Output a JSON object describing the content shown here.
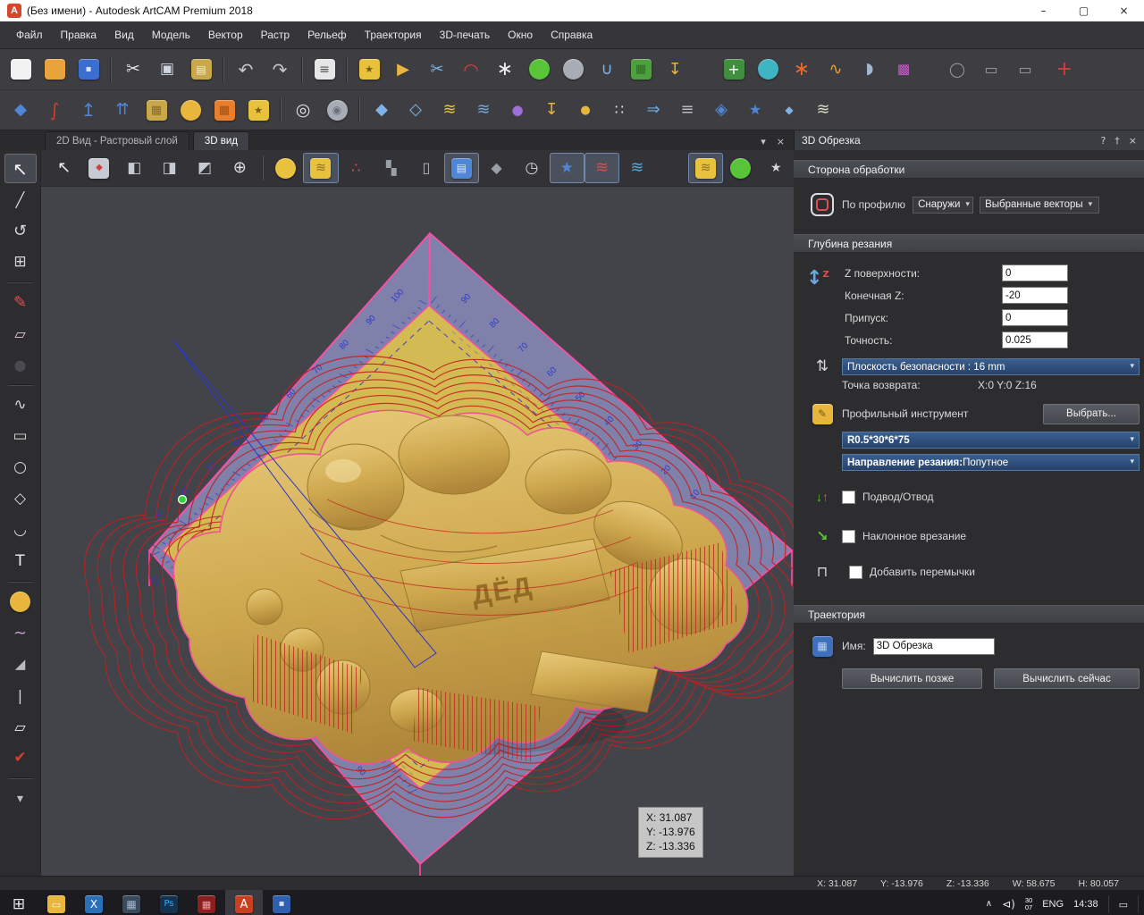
{
  "window": {
    "title": "(Без имени) - Autodesk ArtCAM Premium 2018",
    "app_initial": "A"
  },
  "colors": {
    "plane_yellow": "#d4ba52",
    "plane_purple": "#7f81ab",
    "edge_pink": "#ff4da6",
    "toolpath_red": "#c21f1f",
    "ruler_blue": "#2b39c9",
    "viewport_bg": "#43444a",
    "accent_blue": "#31547f"
  },
  "menu": {
    "items": [
      "Файл",
      "Правка",
      "Вид",
      "Модель",
      "Вектор",
      "Растр",
      "Рельеф",
      "Траектория",
      "3D-печать",
      "Окно",
      "Справка"
    ]
  },
  "toolbar_file": [
    {
      "name": "new-model-icon",
      "chip": "#f2f2f2"
    },
    {
      "name": "open-model-icon",
      "chip": "#e8a33d"
    },
    {
      "name": "save-model-icon",
      "chip": "#3a6fd0",
      "g": "▪",
      "fg": "#d8e4f5",
      "fs": 10
    },
    {
      "sep": true
    },
    {
      "name": "cut-icon",
      "g": "✂",
      "fg": "#e0e0e0",
      "fs": 19
    },
    {
      "name": "copy-icon",
      "g": "▣",
      "fg": "#cfd6df",
      "fs": 17
    },
    {
      "name": "paste-icon",
      "chip": "#c8a84b",
      "g": "▤",
      "fg": "#f5ead0",
      "fs": 12
    },
    {
      "sep": true
    },
    {
      "name": "undo-icon",
      "g": "↶",
      "fg": "#c8c8c8",
      "fs": 20
    },
    {
      "name": "redo-icon",
      "g": "↷",
      "fg": "#c8c8c8",
      "fs": 20
    },
    {
      "sep": true
    },
    {
      "name": "job-sheet-icon",
      "chip": "#e6e6e6",
      "g": "≡",
      "fg": "#555555",
      "fs": 14
    },
    {
      "sep": true
    },
    {
      "name": "import-vectors-icon",
      "chip": "#e8c23d",
      "g": "★",
      "fg": "#7a5a10",
      "fs": 11
    },
    {
      "name": "vector-doctor-icon",
      "g": "▶",
      "fg": "#e8b63d",
      "fs": 18
    },
    {
      "name": "trim-vectors-icon",
      "g": "✂",
      "fg": "#7fb3e8",
      "fs": 18
    },
    {
      "name": "fillet-tool-icon",
      "g": "◠",
      "fg": "#d84040",
      "fs": 20
    },
    {
      "name": "paste-along-curve-icon",
      "g": "∗",
      "fg": "#eeeeee",
      "fs": 22
    },
    {
      "name": "sphere-tool-icon",
      "chip": "#58c437",
      "round": true
    },
    {
      "name": "mesh-tool-icon",
      "chip": "#a8adb5",
      "round": true
    },
    {
      "name": "extrude-tool-icon",
      "g": "∪",
      "fg": "#7fb3e8",
      "fs": 18
    },
    {
      "name": "texture-chip-icon",
      "chip": "#4f9e3f",
      "g": "▦",
      "fg": "#2c6e22",
      "fs": 13
    },
    {
      "name": "pin-tool-icon",
      "g": "↧",
      "fg": "#e8b63d",
      "fs": 18
    },
    {
      "gap": 28
    },
    {
      "name": "add-clipart-icon",
      "chip": "#3f8f3f",
      "g": "+",
      "fg": "#ffffff",
      "fs": 16
    },
    {
      "name": "smooth-blob-icon",
      "chip": "#3fb5c4",
      "round": true
    },
    {
      "name": "burst-tool-icon",
      "g": "∗",
      "fg": "#e86830",
      "fs": 22
    },
    {
      "name": "swirl-tool-icon",
      "g": "∿",
      "fg": "#e8a030",
      "fs": 18
    },
    {
      "name": "wrap-tool-icon",
      "g": "◗",
      "fg": "#9fb6d0",
      "fs": 17
    },
    {
      "name": "two-rail-icon",
      "g": "▩",
      "fg": "#d05ad0",
      "fs": 15
    },
    {
      "gap": 22
    },
    {
      "name": "ghost-circle-icon",
      "g": "◯",
      "fg": "#9a9aa0",
      "fs": 16
    },
    {
      "name": "ghost-slot-1-icon",
      "g": "▭",
      "fg": "#9a9aa0",
      "fs": 16
    },
    {
      "name": "ghost-slot-2-icon",
      "g": "▭",
      "fg": "#9a9aa0",
      "fs": 16
    },
    {
      "gap": 6
    },
    {
      "name": "transform-mode-icon",
      "g": "+",
      "fg": "#d83a3a",
      "fs": 22
    }
  ],
  "toolbar_relief": [
    {
      "name": "relief-smooth-icon",
      "g": "◆",
      "fg": "#4f86d8",
      "fs": 18
    },
    {
      "name": "relief-reset-icon",
      "g": "∫",
      "fg": "#d04030",
      "fs": 20
    },
    {
      "name": "relief-raise-icon",
      "g": "↥",
      "fg": "#4f86d8",
      "fs": 20
    },
    {
      "name": "relief-scale-icon",
      "g": "⇈",
      "fg": "#4f86d8",
      "fs": 18
    },
    {
      "name": "weave-wizard-icon",
      "chip": "#c8a84b",
      "g": "▦",
      "fg": "#8a6b2a",
      "fs": 13
    },
    {
      "name": "shape-droplet-icon",
      "chip": "#e8b63d",
      "round": true
    },
    {
      "name": "texture-relief-icon",
      "chip": "#e87f2f",
      "g": "▦",
      "fg": "#a04f10",
      "fs": 13
    },
    {
      "name": "import-relief-icon",
      "chip": "#e8c23d",
      "g": "★",
      "fg": "#7a5a10",
      "fs": 11
    },
    {
      "sep": true
    },
    {
      "name": "zoom-objects-icon",
      "g": "◎",
      "fg": "#e0e0e0",
      "fs": 19
    },
    {
      "name": "preview-relief-icon",
      "chip": "#a8adb5",
      "round": true,
      "g": "◉",
      "fg": "#6a707a",
      "fs": 12
    },
    {
      "sep": true
    },
    {
      "name": "layer-flat-icon",
      "g": "◆",
      "fg": "#7fb3e8",
      "fs": 18
    },
    {
      "name": "layer-offset-icon",
      "g": "◇",
      "fg": "#7fb3e8",
      "fs": 18
    },
    {
      "name": "layer-gold-icon",
      "g": "≋",
      "fg": "#e8c23d",
      "fs": 18
    },
    {
      "name": "layer-blue-icon",
      "g": "≋",
      "fg": "#6fa8dc",
      "fs": 18
    },
    {
      "name": "layer-sphere-icon",
      "g": "●",
      "fg": "#9f6fd8",
      "fs": 15
    },
    {
      "name": "layer-pin-icon",
      "g": "↧",
      "fg": "#e8b63d",
      "fs": 18
    },
    {
      "name": "layer-drop-icon",
      "g": "●",
      "fg": "#e8b63d",
      "fs": 13
    },
    {
      "name": "layer-scatter-icon",
      "g": "∷",
      "fg": "#e8e8e8",
      "fs": 16
    },
    {
      "name": "layer-shift-icon",
      "g": "⇒",
      "fg": "#6fa8dc",
      "fs": 18
    },
    {
      "name": "layer-stack-icon",
      "g": "≡",
      "fg": "#b8b8c0",
      "fs": 18
    },
    {
      "name": "layer-diamond-icon",
      "g": "◈",
      "fg": "#4f86d8",
      "fs": 18
    },
    {
      "name": "layer-star-icon",
      "g": "★",
      "fg": "#4f86d8",
      "fs": 16
    },
    {
      "name": "layer-small-icon",
      "g": "◆",
      "fg": "#7fb3e8",
      "fs": 12
    },
    {
      "name": "layer-pale-icon",
      "g": "≋",
      "fg": "#d8d8c8",
      "fs": 18
    }
  ],
  "toolbar_view": [
    {
      "name": "select-cursor-icon",
      "g": "↖",
      "fg": "#f0f0f0",
      "fs": 18
    },
    {
      "name": "iso-view-icon",
      "chip": "#c6cad2",
      "g": "◆",
      "fg": "#d04040",
      "fs": 10
    },
    {
      "name": "view-front-icon",
      "g": "◧",
      "fg": "#c6cad2",
      "fs": 17
    },
    {
      "name": "view-side-icon",
      "g": "◨",
      "fg": "#c6cad2",
      "fs": 17
    },
    {
      "name": "view-top-icon",
      "g": "◩",
      "fg": "#c6cad2",
      "fs": 17
    },
    {
      "name": "zoom-view-icon",
      "g": "⊕",
      "fg": "#e0e0e0",
      "fs": 18
    },
    {
      "sep": true
    },
    {
      "name": "light-icon",
      "chip": "#e8c23d",
      "round": true
    },
    {
      "name": "draft-layer-icon",
      "chip": "#e8c23d",
      "g": "≋",
      "fg": "#8a6b2a",
      "fs": 14,
      "active": true
    },
    {
      "name": "origin-triad-icon",
      "g": "∴",
      "fg": "#e05050",
      "fs": 16
    },
    {
      "name": "puzzle-icon",
      "g": "▚",
      "fg": "#9aa0a8",
      "fs": 15
    },
    {
      "name": "cylinder-icon",
      "g": "▯",
      "fg": "#b8b8c0",
      "fs": 16
    },
    {
      "name": "block-model-icon",
      "chip": "#4f86d8",
      "g": "▤",
      "fg": "#dce8f8",
      "fs": 12,
      "active": true
    },
    {
      "name": "material-icon",
      "g": "◆",
      "fg": "#9aa0a8",
      "fs": 16
    },
    {
      "name": "simulate-clock-icon",
      "g": "◷",
      "fg": "#d8d8d8",
      "fs": 17
    },
    {
      "name": "toolpath-star-icon",
      "g": "★",
      "fg": "#4f86d8",
      "fs": 17,
      "active": true
    },
    {
      "name": "toolpath-layers-icon",
      "g": "≋",
      "fg": "#d05050",
      "fs": 18,
      "active": true
    },
    {
      "name": "levels-icon",
      "g": "≋",
      "fg": "#58a8d0",
      "fs": 18
    },
    {
      "gap": 38
    },
    {
      "name": "draft-gold-icon",
      "chip": "#e8c23d",
      "g": "≋",
      "fg": "#8a6b2a",
      "fs": 14,
      "active": true
    },
    {
      "name": "shape-green-icon",
      "chip": "#58c437",
      "round": true
    },
    {
      "name": "find-vectors-icon",
      "g": "★",
      "fg": "#d8d8d8",
      "fs": 14
    }
  ],
  "toolbar_draw": [
    {
      "name": "select-tool-icon",
      "g": "↖",
      "fg": "#f5f5f5",
      "fs": 20,
      "active": true
    },
    {
      "name": "node-edit-tool-icon",
      "g": "╱",
      "fg": "#d8d8d8",
      "fs": 16
    },
    {
      "name": "transform-tool-icon",
      "g": "↺",
      "fg": "#d8d8d8",
      "fs": 18
    },
    {
      "name": "distort-grid-tool-icon",
      "g": "⊞",
      "fg": "#d8d8d8",
      "fs": 17
    },
    {
      "sep": true
    },
    {
      "name": "draw-tool-icon",
      "g": "✎",
      "fg": "#e05050",
      "fs": 18
    },
    {
      "name": "erase-tool-icon",
      "g": "▱",
      "fg": "#e8c8d8",
      "fs": 16
    },
    {
      "name": "flood-fill-tool-icon",
      "g": "●",
      "fg": "#4a4a50",
      "fs": 16
    },
    {
      "sep": true
    },
    {
      "name": "polyline-tool-icon",
      "g": "∿",
      "fg": "#d8d8d8",
      "fs": 17
    },
    {
      "name": "rectangle-tool-icon",
      "g": "▭",
      "fg": "#d8d8d8",
      "fs": 17
    },
    {
      "name": "ellipse-tool-icon",
      "g": "○",
      "fg": "#d8d8d8",
      "fs": 17
    },
    {
      "name": "polygon-tool-icon",
      "g": "◇",
      "fg": "#d8d8d8",
      "fs": 17
    },
    {
      "name": "arc-tool-icon",
      "g": "◡",
      "fg": "#d8d8d8",
      "fs": 17
    },
    {
      "name": "text-tool-icon",
      "g": "T",
      "fg": "#f0f0f0",
      "fs": 17
    },
    {
      "sep": true
    },
    {
      "name": "sculpt-smooth-tool-icon",
      "chip": "#e8b63d",
      "round": true
    },
    {
      "name": "smudge-tool-icon",
      "g": "∼",
      "fg": "#c8a0d0",
      "fs": 18
    },
    {
      "name": "deposit-tool-icon",
      "g": "◢",
      "fg": "#b8b8c0",
      "fs": 15
    },
    {
      "name": "brush-tool-icon",
      "g": "|",
      "fg": "#d8d8d8",
      "fs": 16
    },
    {
      "name": "erase-relief-tool-icon",
      "g": "▱",
      "fg": "#f0f0f0",
      "fs": 16
    },
    {
      "name": "smooth-relief-tool-icon",
      "g": "✔",
      "fg": "#d04030",
      "fs": 17
    },
    {
      "sep": true
    },
    {
      "name": "more-tools-icon",
      "g": "▾",
      "fg": "#c0c0c0",
      "fs": 14
    }
  ],
  "tabs": {
    "tab_2d": "2D Вид - Растровый слой",
    "tab_3d": "3D вид"
  },
  "viewport": {
    "coords": {
      "x": "X: 31.087",
      "y": "Y: -13.976",
      "z": "Z: -13.336"
    },
    "model_text": "ДЁД",
    "ruler_left": [
      "10",
      "20",
      "30",
      "40",
      "50",
      "60",
      "70",
      "80",
      "90",
      "100"
    ],
    "ruler_right": [
      "90",
      "80",
      "70",
      "60",
      "50",
      "40",
      "30",
      "20",
      "10"
    ],
    "ruler_bottom": [
      "10",
      "20",
      "30",
      "40",
      "50",
      "60",
      "70",
      "80",
      "90"
    ]
  },
  "panel": {
    "title": "3D Обрезка",
    "help_icon": "?",
    "pin_icon": "†",
    "close_icon": "×",
    "section_machining": "Сторона обработки",
    "profile_label": "По профилю",
    "profile_side": "Снаружи",
    "profile_vectors": "Выбранные векторы",
    "section_depth": "Глубина резания",
    "fields": [
      {
        "label": "Z поверхности:",
        "value": "0"
      },
      {
        "label": "Конечная Z:",
        "value": "-20"
      },
      {
        "label": "Припуск:",
        "value": "0"
      },
      {
        "label": "Точность:",
        "value": "0.025"
      }
    ],
    "safety_plane": "Плоскость безопасности : 16 mm",
    "return_point_label": "Точка возврата:",
    "return_point_value": "X:0 Y:0 Z:16",
    "tool_label": "Профильный инструмент",
    "tool_select_button": "Выбрать...",
    "tool_value": "R0.5*30*6*75",
    "direction_label": "Направление резания:",
    "direction_value": " Попутное",
    "checkbox_lead": "Подвод/Отвод",
    "checkbox_ramp": "Наклонное врезание",
    "checkbox_bridges": "Добавить перемычки",
    "section_toolpath": "Траектория",
    "name_label": "Имя:",
    "name_value": "3D Обрезка",
    "calc_later": "Вычислить позже",
    "calc_now": "Вычислить сейчас"
  },
  "statusbar": {
    "x": "X: 31.087",
    "y": "Y: -13.976",
    "z": "Z: -13.336",
    "w": "W: 58.675",
    "h": "H: 80.057"
  },
  "taskbar": {
    "apps": [
      {
        "name": "start-button",
        "g": "⊞",
        "fg": "#e8e8e8",
        "fs": 17
      },
      {
        "name": "taskbar-explorer",
        "chip": "#e8b63d",
        "g": "▭",
        "fg": "#fdf3d8",
        "fs": 11
      },
      {
        "name": "taskbar-app-x",
        "chip": "#2a6fb8",
        "g": "X",
        "fg": "#ffffff",
        "fs": 12
      },
      {
        "name": "taskbar-app-grid",
        "chip": "#3a4a5a",
        "g": "▦",
        "fg": "#9fb8d0",
        "fs": 12
      },
      {
        "name": "taskbar-photoshop",
        "chip": "#16324f",
        "g": "Ps",
        "fg": "#31a8ff",
        "fs": 10
      },
      {
        "name": "taskbar-app-red",
        "chip": "#8a1f1f",
        "g": "▦",
        "fg": "#e8a0a0",
        "fs": 11
      },
      {
        "name": "taskbar-artcam",
        "chip": "#c8401f",
        "g": "A",
        "fg": "#ffffff",
        "fs": 13,
        "active": true
      },
      {
        "name": "taskbar-app-save",
        "chip": "#2f5fae",
        "g": "▪",
        "fg": "#cfe0f5",
        "fs": 10
      }
    ],
    "tray_date_top": "30",
    "tray_date_bottom": "07",
    "lang": "ENG",
    "time": "14:38"
  }
}
